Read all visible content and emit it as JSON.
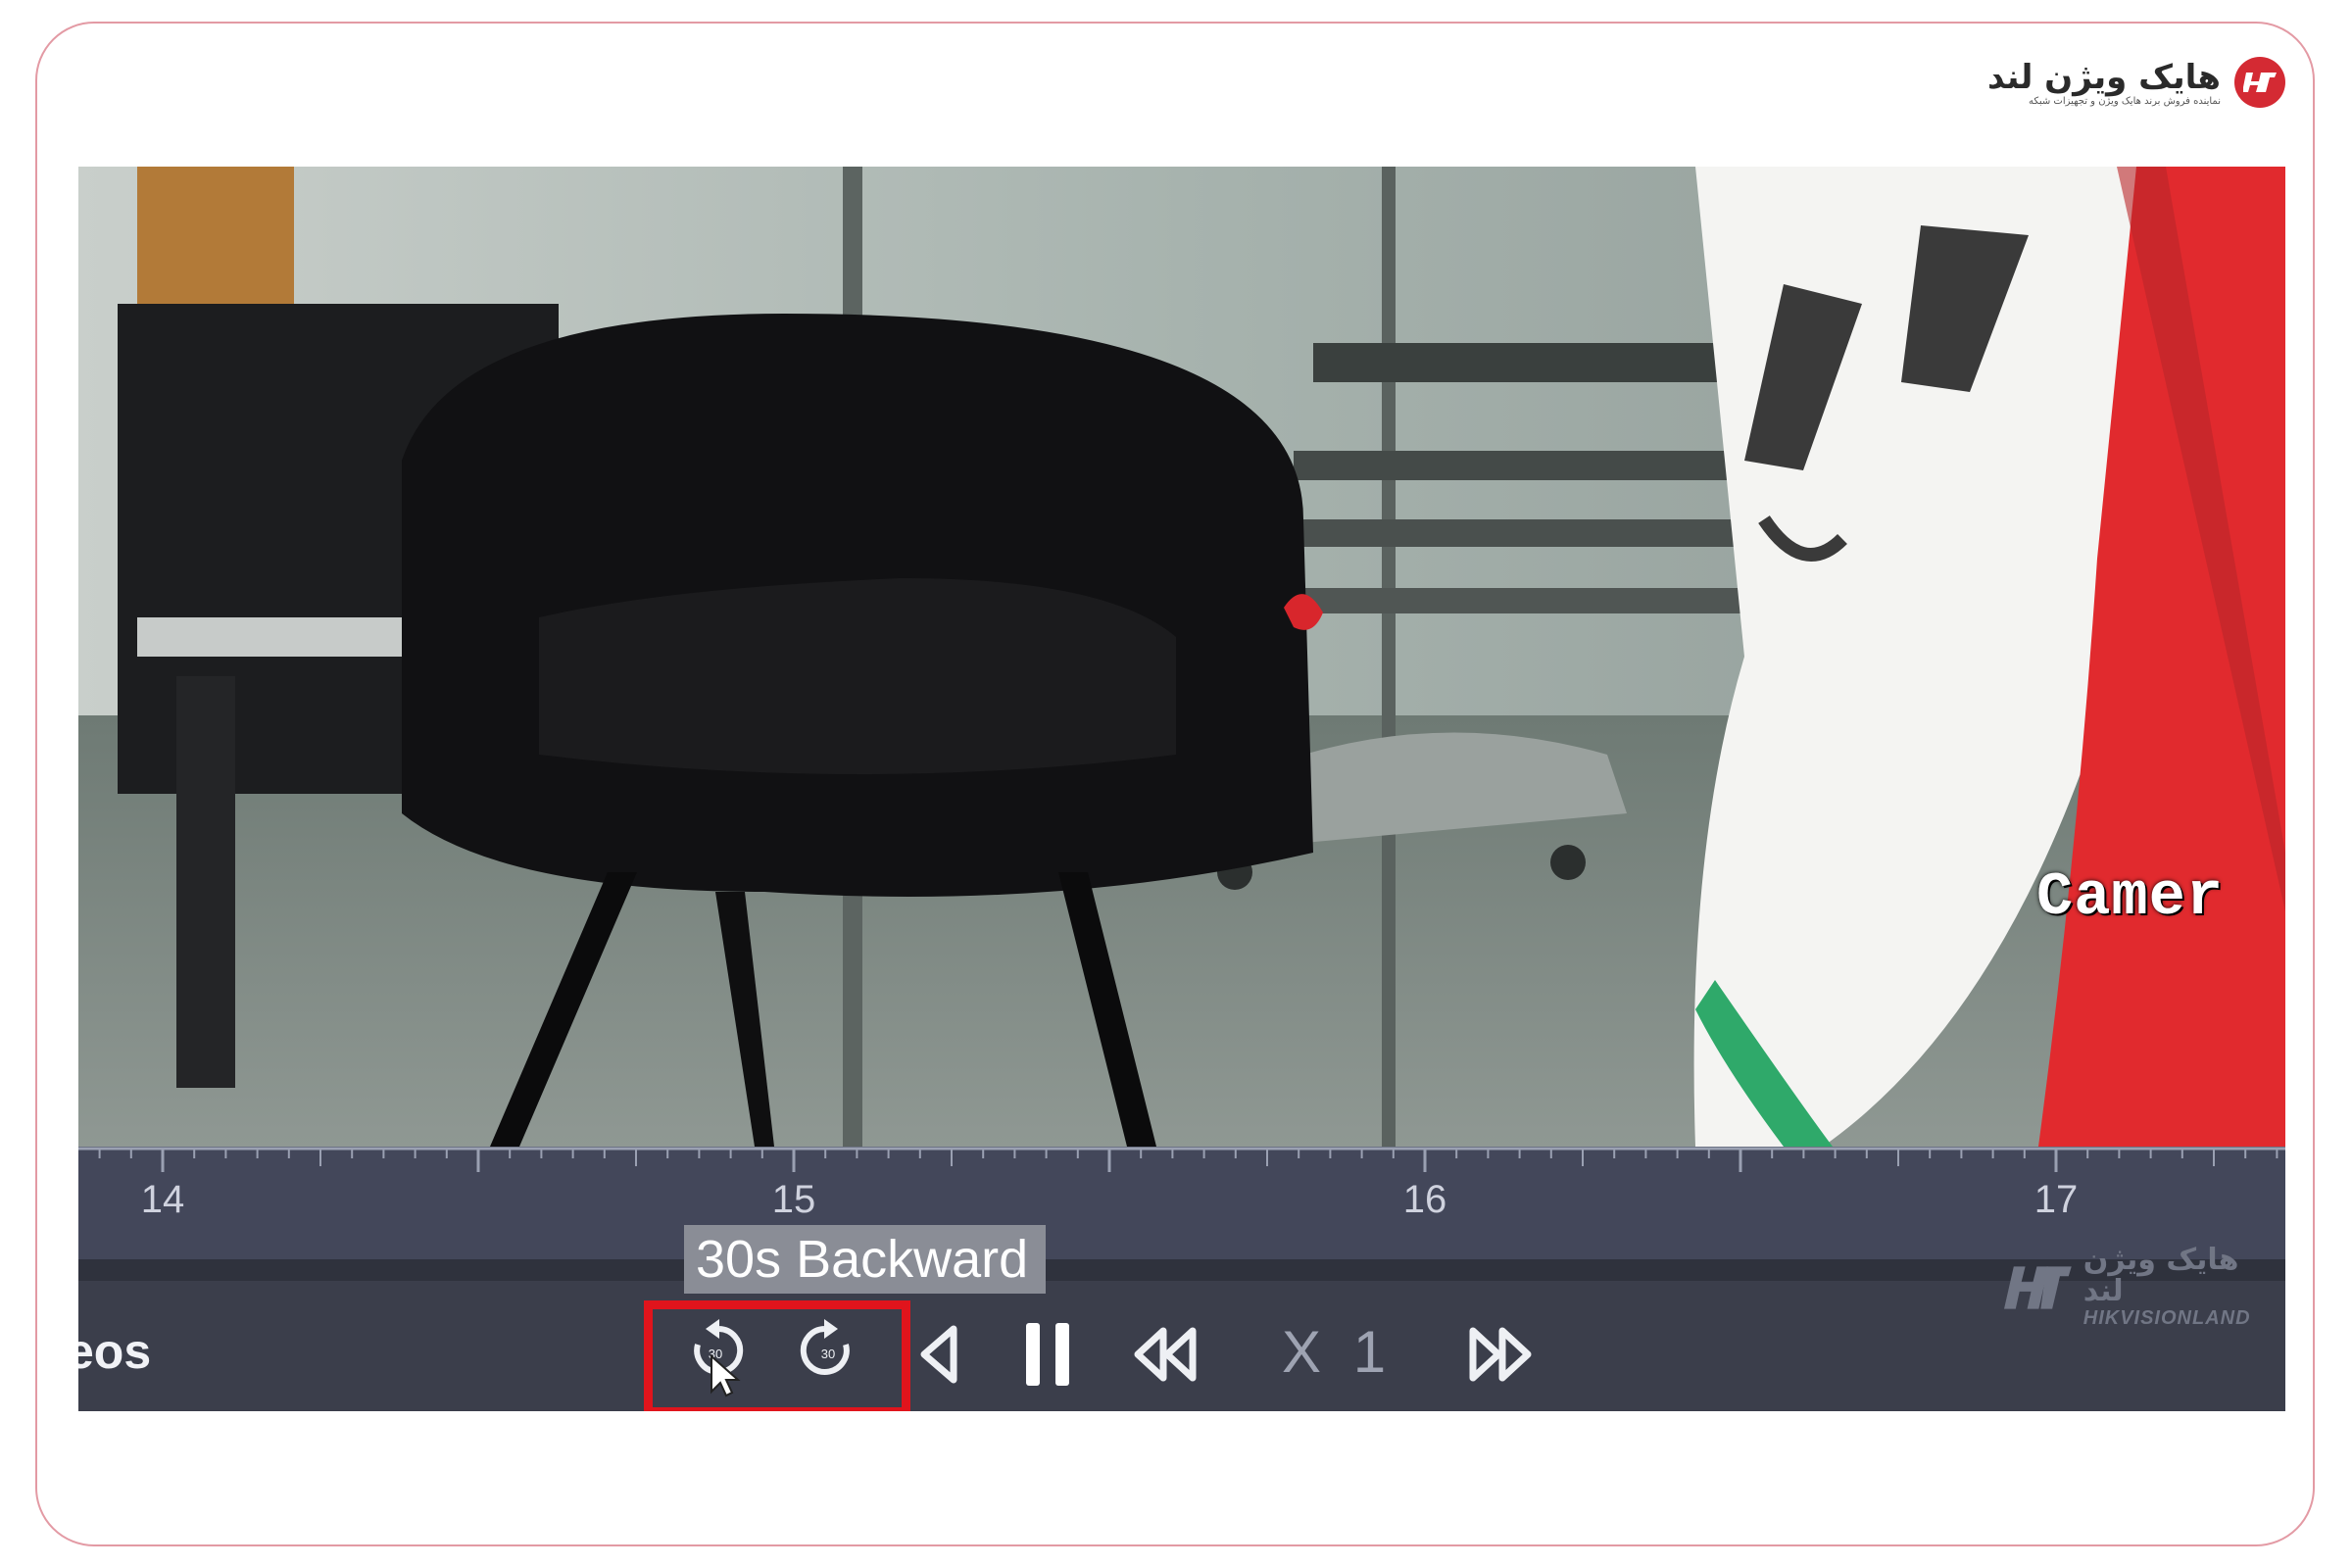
{
  "brand": {
    "name": "هایک ویژن لند",
    "tagline": "نماینده فروش برند هایک ویژن و تجهیزات شبکه",
    "badge_text": "H7",
    "accent": "#d42a33"
  },
  "video": {
    "osd_text": "Camer"
  },
  "timeline": {
    "tick_labels": [
      "14",
      "15",
      "16",
      "17"
    ]
  },
  "controls": {
    "partial_label": "eos",
    "tooltip": "30s Backward",
    "speed_label": "X 1",
    "buttons": [
      {
        "name": "30s-backward",
        "icon": "rotate-ccw-30-icon"
      },
      {
        "name": "30s-forward",
        "icon": "rotate-cw-30-icon"
      },
      {
        "name": "reverse-play",
        "icon": "triangle-left-icon"
      },
      {
        "name": "pause",
        "icon": "pause-icon"
      },
      {
        "name": "slow-down",
        "icon": "double-left-icon"
      },
      {
        "name": "speed-up",
        "icon": "double-right-icon"
      }
    ],
    "highlight_color": "#e0141c"
  },
  "watermark": {
    "fa": "هایک ویژن لند",
    "en": "HIKVISIONLAND",
    "badge_text": "H7"
  }
}
